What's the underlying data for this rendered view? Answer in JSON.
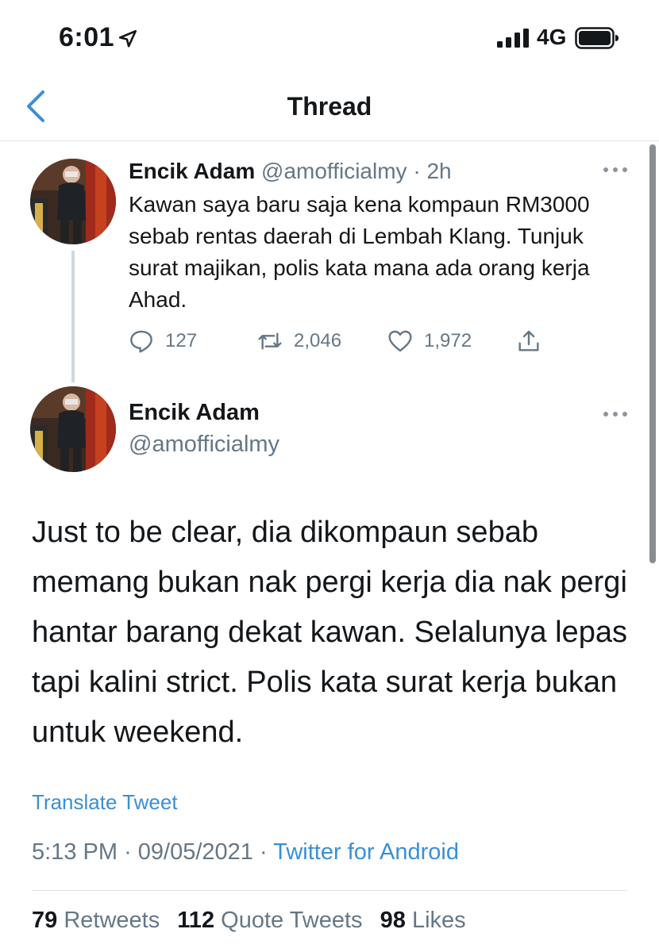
{
  "status_bar": {
    "time": "6:01",
    "network": "4G",
    "icons": [
      "location-arrow-icon",
      "cellular-signal-icon",
      "battery-icon"
    ]
  },
  "nav": {
    "title": "Thread",
    "back_icon": "chevron-left-icon"
  },
  "tweets": [
    {
      "name": "Encik Adam",
      "handle": "@amofficialmy",
      "separator": "·",
      "time_ago": "2h",
      "text": "Kawan saya baru saja kena kompaun RM3000 sebab rentas daerah di Lembah Klang. Tunjuk surat majikan, polis kata mana ada orang kerja Ahad.",
      "actions": {
        "replies": "127",
        "retweets": "2,046",
        "likes": "1,972"
      }
    },
    {
      "name": "Encik Adam",
      "handle": "@amofficialmy",
      "text": "Just to be clear, dia dikompaun sebab memang bukan nak pergi kerja dia nak pergi hantar barang dekat kawan. Selalunya lepas tapi kalini strict. Polis kata surat kerja bukan untuk weekend.",
      "translate_label": "Translate Tweet",
      "time": "5:13 PM",
      "separator": "·",
      "date": "09/05/2021",
      "source": "Twitter for Android",
      "stats": {
        "retweets_count": "79",
        "retweets_label": "Retweets",
        "quotes_count": "112",
        "quotes_label": "Quote Tweets",
        "likes_count": "98",
        "likes_label": "Likes"
      }
    }
  ],
  "colors": {
    "accent": "#3a8fd6",
    "text": "#14171a",
    "secondary": "#657786",
    "divider": "#dfe3e6"
  }
}
